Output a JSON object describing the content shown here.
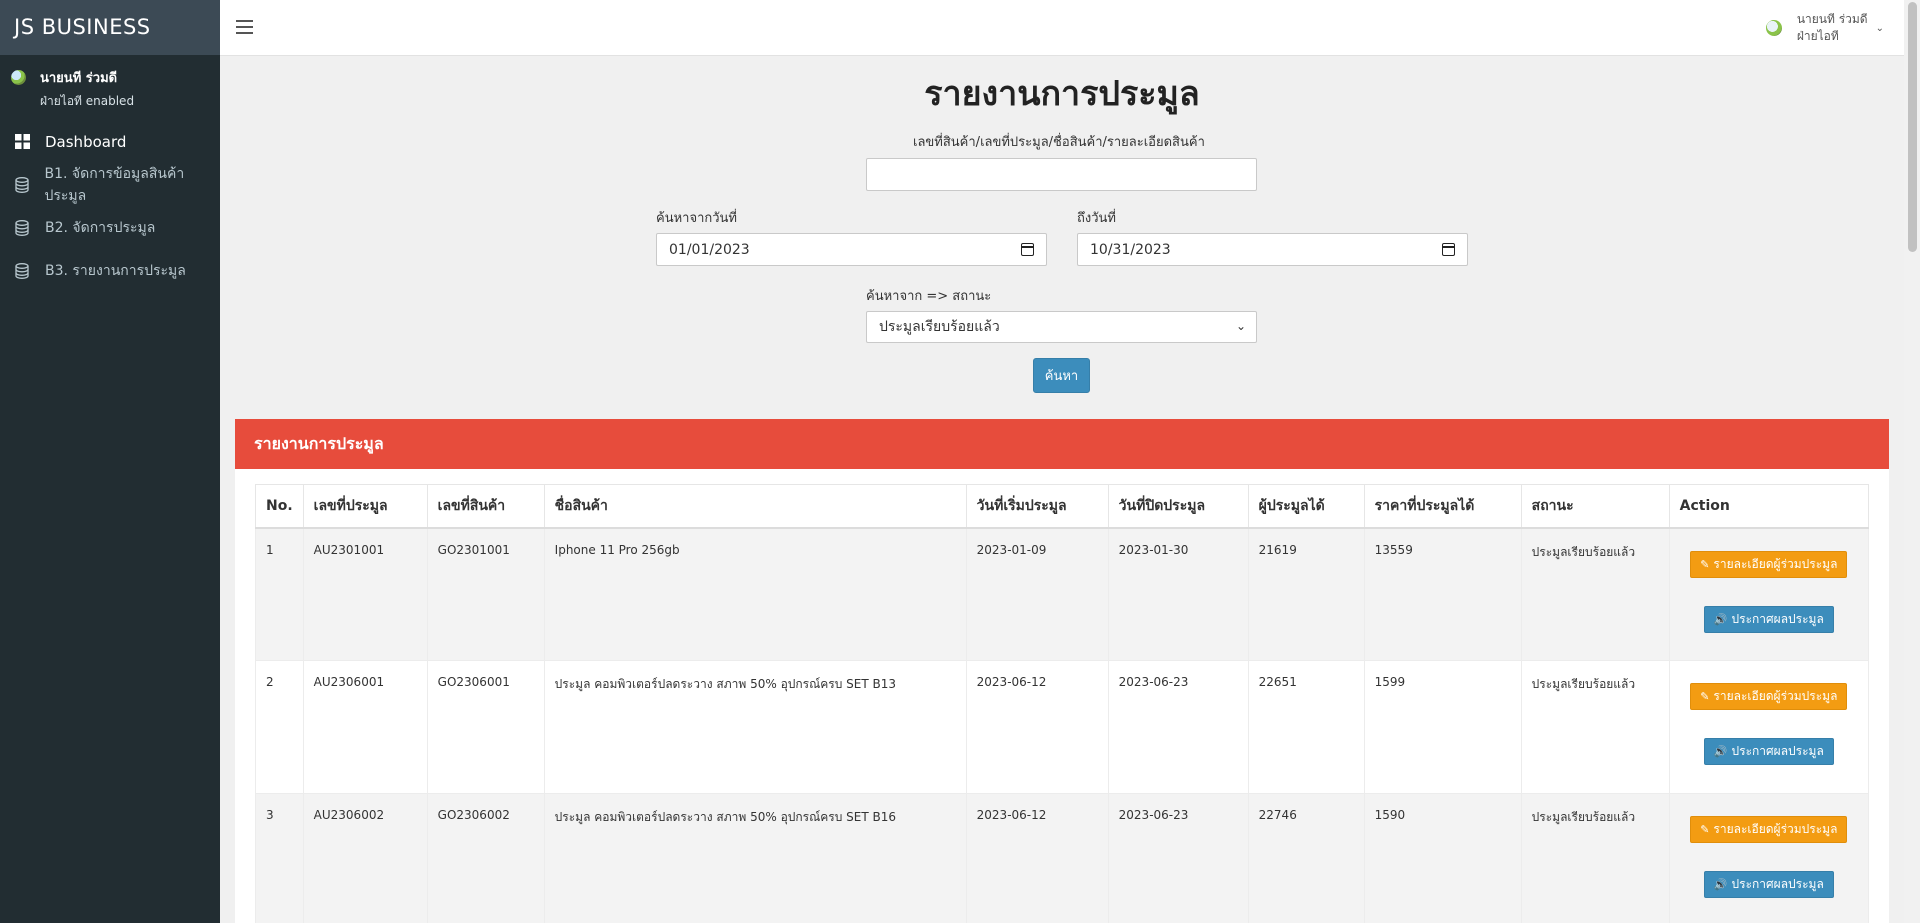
{
  "sidebar": {
    "brand": "JS  BUSINESS",
    "user": {
      "name": "นายนที ร่วมดี",
      "status": "ฝ่ายไอที enabled"
    },
    "items": [
      {
        "label": "Dashboard",
        "icon": "dashboard-icon"
      },
      {
        "label": "B1. จัดการข้อมูลสินค้าประมูล",
        "icon": "database-icon"
      },
      {
        "label": "B2. จัดการประมูล",
        "icon": "database-icon"
      },
      {
        "label": "B3. รายงานการประมูล",
        "icon": "database-icon"
      }
    ]
  },
  "topbar": {
    "menu_icon": "hamburger-icon",
    "user_line1": "นายนที ร่วมดี",
    "user_line2": "ฝ่ายไอที",
    "caret": "⌄"
  },
  "page": {
    "title": "รายงานการประมูล",
    "search_label": "เลขที่สินค้า/เลขที่ประมูล/ชื่อสินค้า/รายละเอียดสินค้า",
    "search_value": "",
    "from_label": "ค้นหาจากวันที่",
    "from_value": "01/01/2023",
    "to_label": "ถึงวันที่",
    "to_value": "10/31/2023",
    "status_label": "ค้นหาจาก => สถานะ",
    "status_value": "ประมูลเรียบร้อยแล้ว",
    "search_button": "ค้นหา"
  },
  "report": {
    "title": "รายงานการประมูล",
    "columns": [
      "No.",
      "เลขที่ประมูล",
      "เลขที่สินค้า",
      "ชื่อสินค้า",
      "วันที่เริ่มประมูล",
      "วันที่ปิดประมูล",
      "ผู้ประมูลได้",
      "ราคาที่ประมูลได้",
      "สถานะ",
      "Action"
    ],
    "detail_button": "รายละเอียดผู้ร่วมประมูล",
    "announce_button": "ประกาศผลประมูล",
    "rows": [
      {
        "no": "1",
        "auction_no": "AU2301001",
        "product_no": "GO2301001",
        "name": "Iphone 11 Pro 256gb",
        "start": "2023-01-09",
        "end": "2023-01-30",
        "winner": "21619",
        "price": "13559",
        "status": "ประมูลเรียบร้อยแล้ว"
      },
      {
        "no": "2",
        "auction_no": "AU2306001",
        "product_no": "GO2306001",
        "name": "ประมูล คอมพิวเตอร์ปลดระวาง สภาพ 50% อุปกรณ์ครบ SET B13",
        "start": "2023-06-12",
        "end": "2023-06-23",
        "winner": "22651",
        "price": "1599",
        "status": "ประมูลเรียบร้อยแล้ว"
      },
      {
        "no": "3",
        "auction_no": "AU2306002",
        "product_no": "GO2306002",
        "name": "ประมูล คอมพิวเตอร์ปลดระวาง สภาพ 50% อุปกรณ์ครบ SET B16",
        "start": "2023-06-12",
        "end": "2023-06-23",
        "winner": "22746",
        "price": "1590",
        "status": "ประมูลเรียบร้อยแล้ว"
      }
    ]
  }
}
